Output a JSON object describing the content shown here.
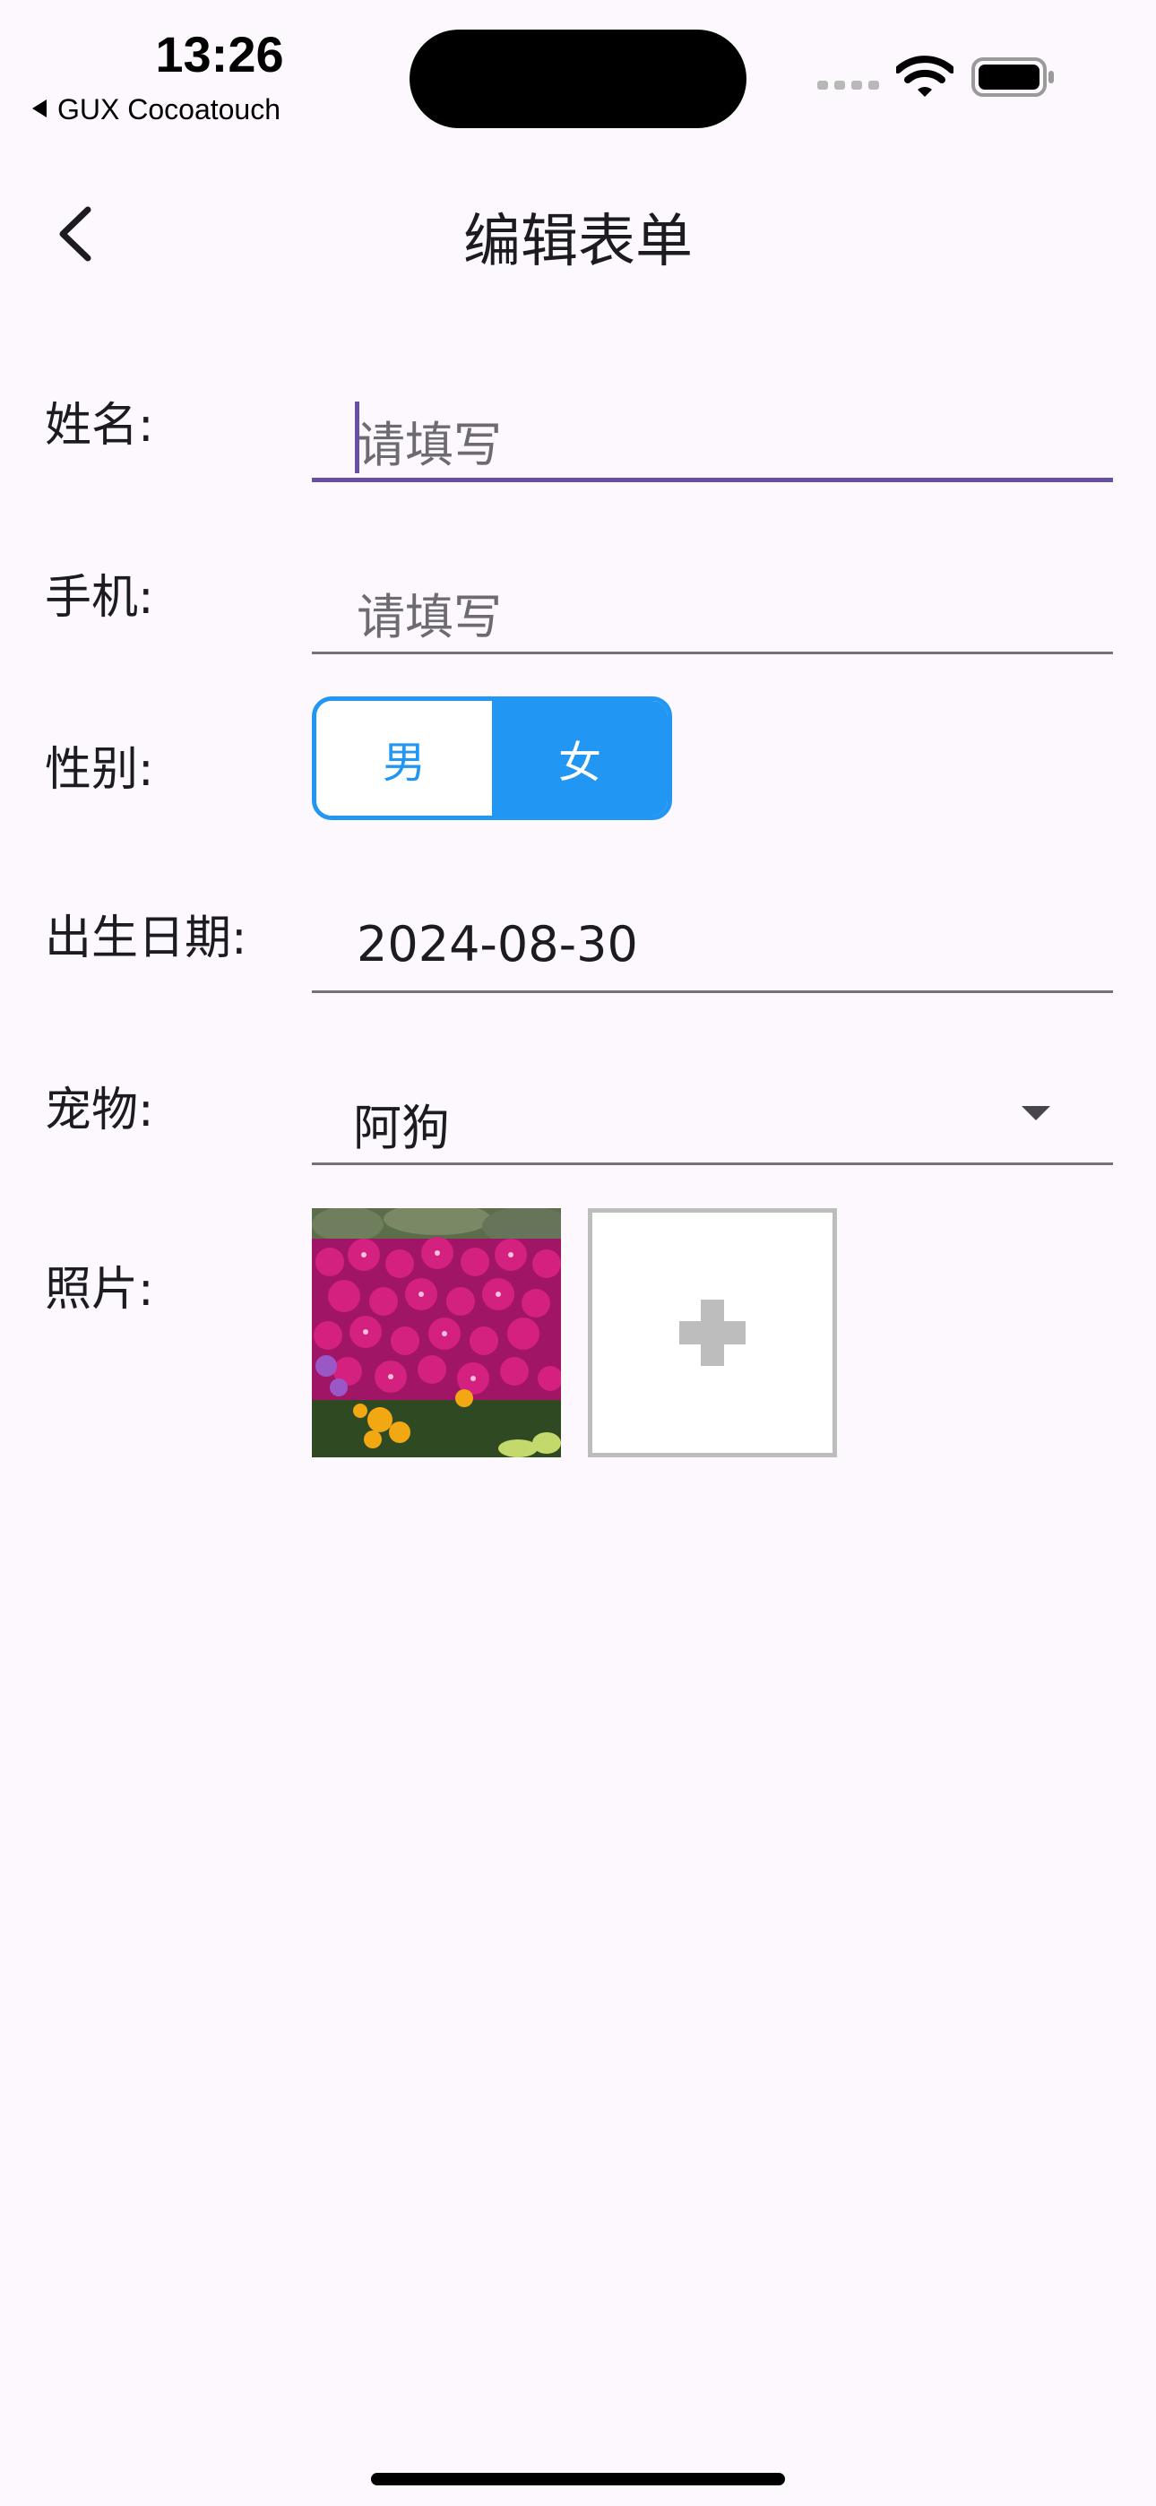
{
  "status_bar": {
    "time": "13:26",
    "back_app": "GUX Cocoatouch"
  },
  "nav": {
    "title": "编辑表单"
  },
  "form": {
    "name": {
      "label": "姓名:",
      "placeholder": "请填写",
      "value": ""
    },
    "phone": {
      "label": "手机:",
      "placeholder": "请填写",
      "value": ""
    },
    "gender": {
      "label": "性别:",
      "options": [
        "男",
        "女"
      ],
      "selected": "女"
    },
    "birthdate": {
      "label": "出生日期:",
      "value": "2024-08-30"
    },
    "pet": {
      "label": "宠物:",
      "value": "阿狗"
    },
    "photos": {
      "label": "照片:"
    }
  },
  "colors": {
    "background": "#FDF7FE",
    "focus": "#6750A4",
    "segment": "#2196F3"
  },
  "icons": [
    "back-chevron-icon",
    "signal-icon",
    "wifi-icon",
    "battery-icon",
    "dropdown-arrow-icon",
    "plus-icon"
  ]
}
